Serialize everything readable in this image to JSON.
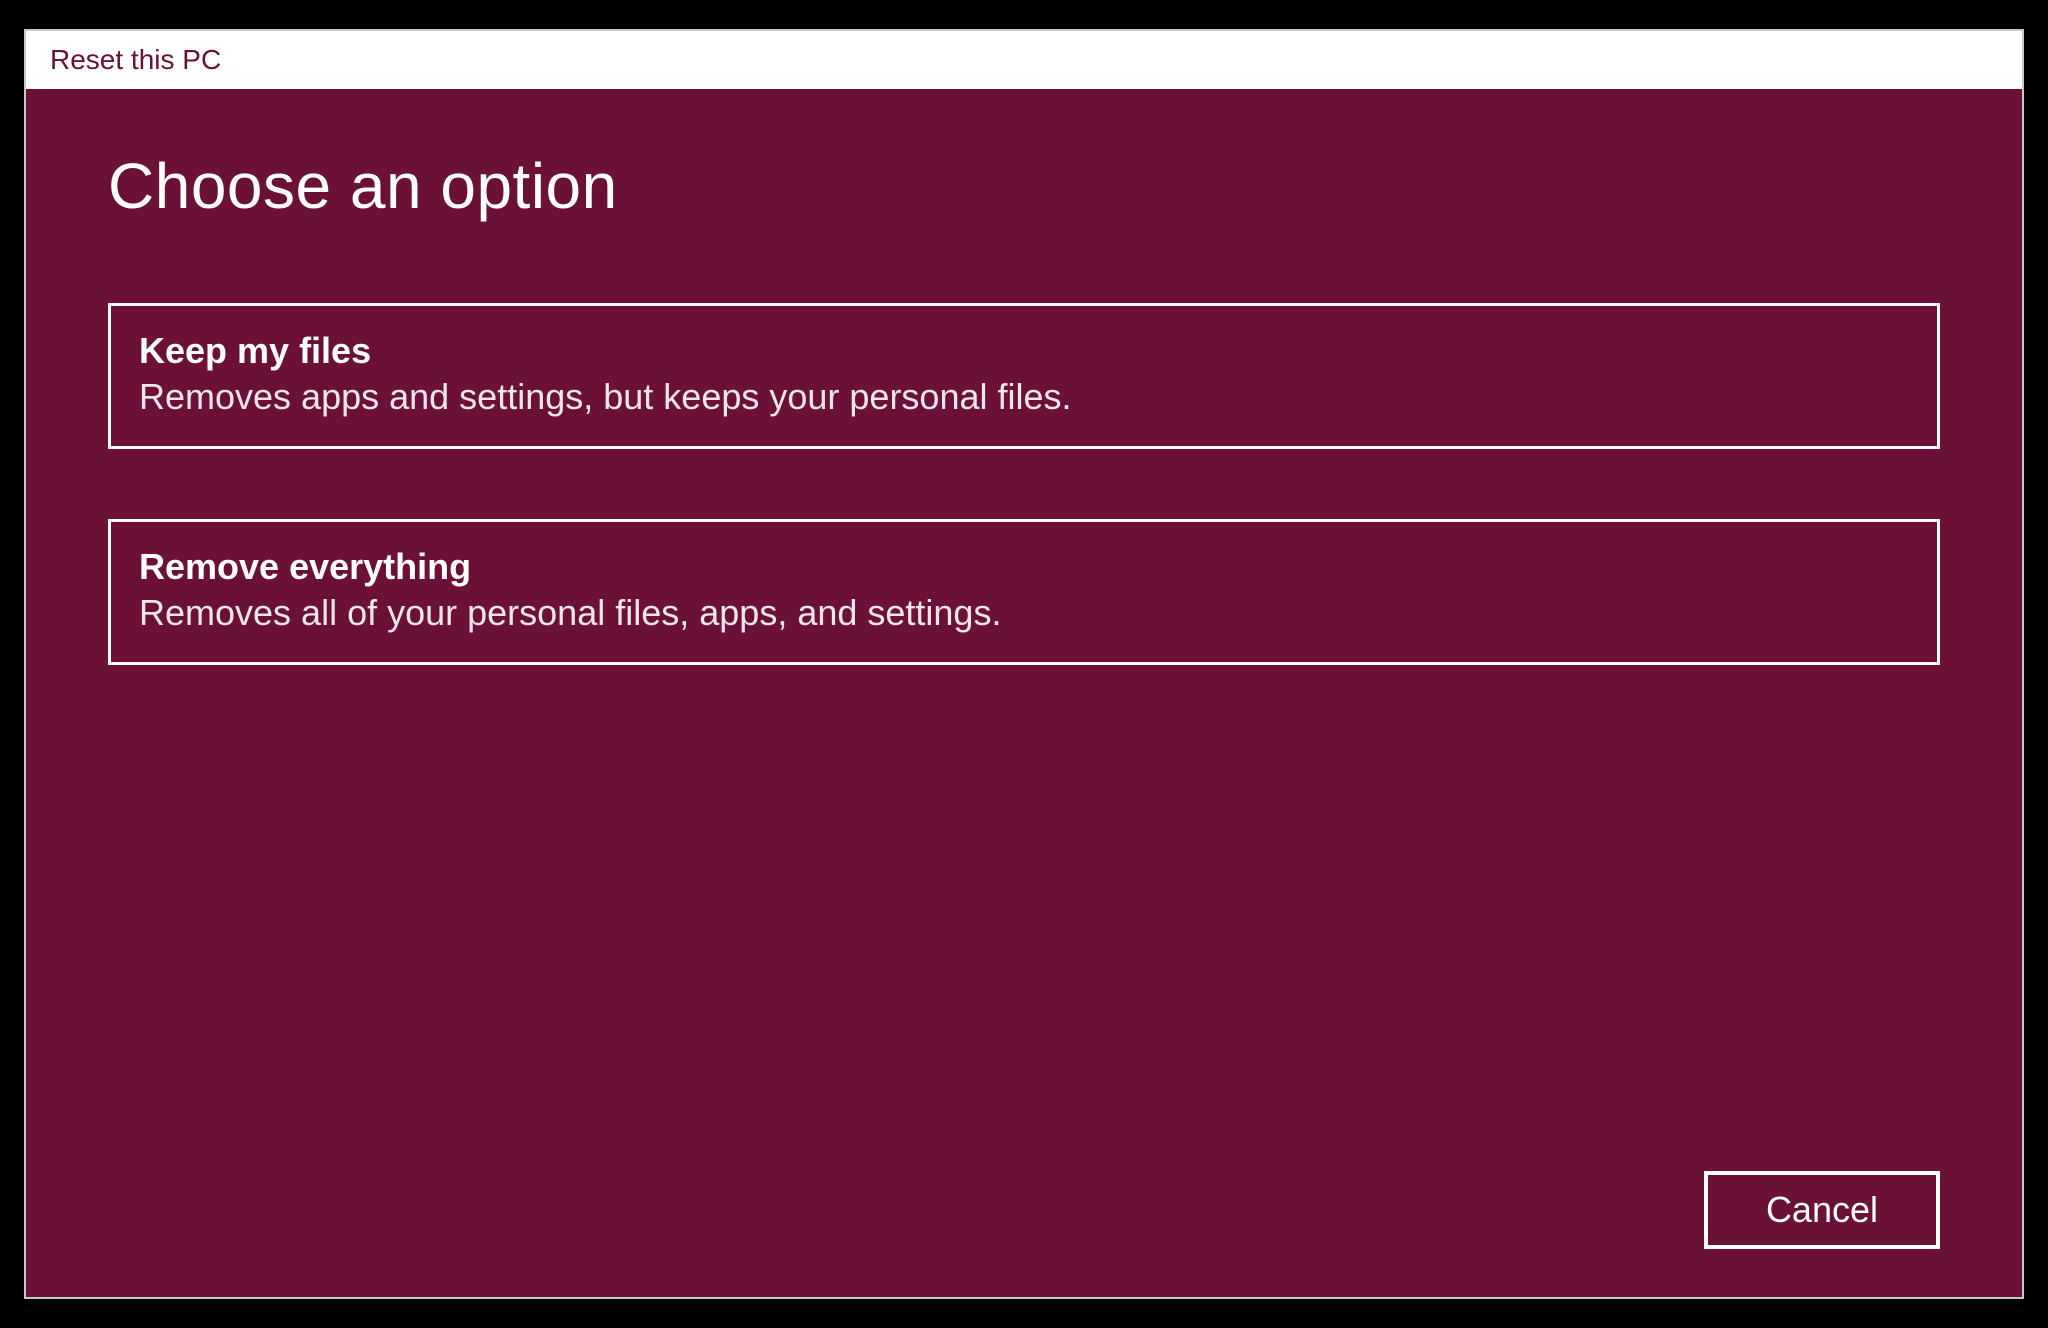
{
  "window": {
    "title": "Reset this PC"
  },
  "main": {
    "heading": "Choose an option",
    "options": [
      {
        "title": "Keep my files",
        "description": "Removes apps and settings, but keeps your personal files."
      },
      {
        "title": "Remove everything",
        "description": "Removes all of your personal files, apps, and settings."
      }
    ]
  },
  "footer": {
    "cancel_label": "Cancel"
  },
  "colors": {
    "accent": "#6b1138",
    "border": "#ffffff",
    "titlebar_bg": "#ffffff"
  }
}
